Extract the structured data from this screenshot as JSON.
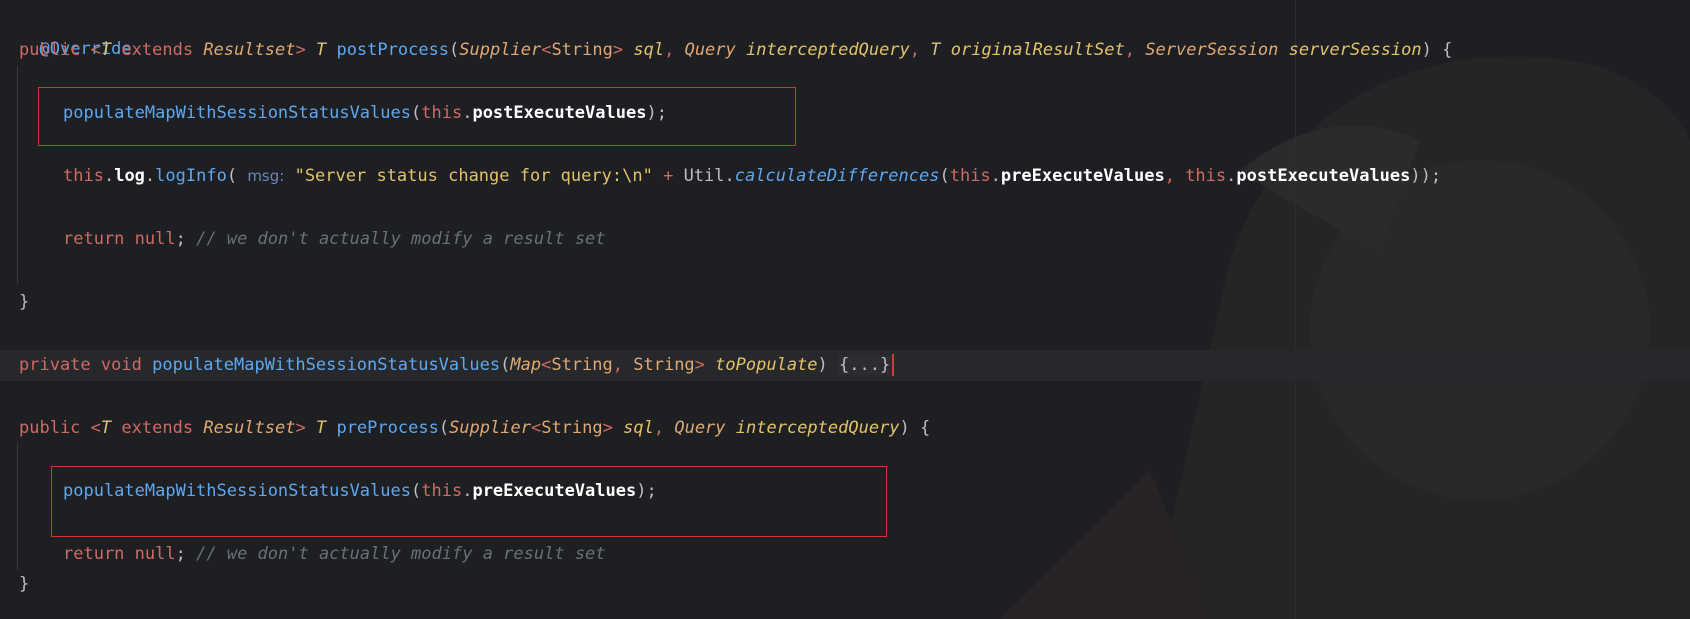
{
  "editor": {
    "language": "Java",
    "colors": {
      "background": "#1e1f22",
      "keyword": "#cf6a64",
      "function": "#5fa8f0",
      "type": "#e0a872",
      "string": "#e3c26a",
      "comment": "#6b6f79",
      "highlight_box": "#d8322f"
    }
  },
  "code": {
    "annotation": "@Override",
    "postProcess": {
      "kw_public": "public",
      "lt": "<",
      "T": "T",
      "kw_extends": "extends",
      "resultset": "Resultset",
      "gt": ">",
      "ret_T": "T",
      "name": "postProcess",
      "open": "(",
      "supplier": "Supplier",
      "string_type": "String",
      "sql": "sql",
      "comma1": ",",
      "query_type": "Query",
      "intercepted": "interceptedQuery",
      "comma2": ",",
      "T2": "T",
      "original": "originalResultSet",
      "comma3": ",",
      "session_type": "ServerSession",
      "session": "serverSession",
      "close": ") {"
    },
    "populate_post": {
      "fn": "populateMapWithSessionStatusValues",
      "kw_this": "this",
      "field": "postExecuteValues",
      "end": ");"
    },
    "log_line": {
      "kw_this": "this",
      "log": "log",
      "logInfo": "logInfo",
      "hint": "msg:",
      "str": "\"Server status change for query:\\n\"",
      "plus": "+",
      "util": "Util",
      "calc": "calculateDifferences",
      "kw_this1": "this",
      "pre": "preExecuteValues",
      "kw_this2": "this",
      "post": "postExecuteValues",
      "end": "));"
    },
    "return_line": {
      "kw_return": "return",
      "kw_null": "null",
      "semi": ";",
      "comment": "// we don't actually modify a result set"
    },
    "brace_close": "}",
    "private_line": {
      "kw_private": "private",
      "kw_void": "void",
      "fn": "populateMapWithSessionStatusValues",
      "map_type": "Map",
      "string1": "String",
      "string2": "String",
      "param": "toPopulate",
      "fold": "{...}"
    },
    "preProcess": {
      "kw_public": "public",
      "T": "T",
      "kw_extends": "extends",
      "resultset": "Resultset",
      "ret_T": "T",
      "name": "preProcess",
      "supplier": "Supplier",
      "string_type": "String",
      "sql": "sql",
      "query_type": "Query",
      "intercepted": "interceptedQuery",
      "close": ") {"
    },
    "populate_pre": {
      "fn": "populateMapWithSessionStatusValues",
      "kw_this": "this",
      "field": "preExecuteValues",
      "end": ");"
    },
    "return_line2": {
      "kw_return": "return",
      "kw_null": "null",
      "semi": ";",
      "comment": "// we don't actually modify a result set"
    },
    "brace_close2": "}"
  }
}
